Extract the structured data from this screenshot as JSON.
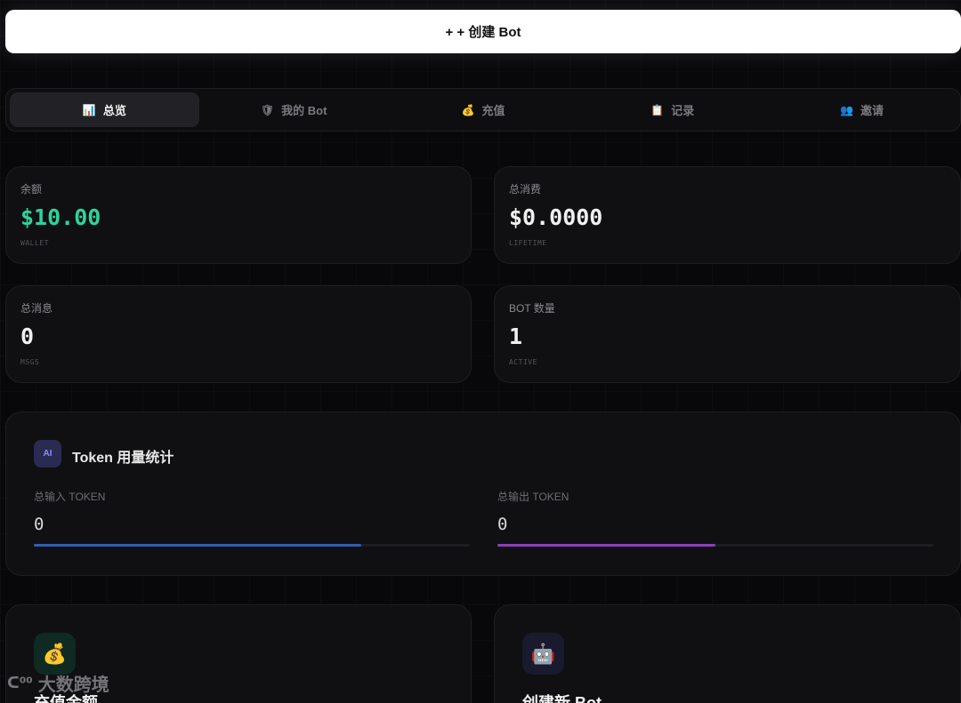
{
  "create_button": {
    "label": "+ + 创建 Bot"
  },
  "tabs": [
    {
      "icon": "📊",
      "label": "总览",
      "active": true
    },
    {
      "icon": "🛡",
      "label": "我的 Bot",
      "active": false
    },
    {
      "icon": "💰",
      "label": "充值",
      "active": false
    },
    {
      "icon": "📋",
      "label": "记录",
      "active": false
    },
    {
      "icon": "👥",
      "label": "邀请",
      "active": false
    }
  ],
  "stats": [
    {
      "label": "余额",
      "value": "$10.00",
      "sub": "WALLET",
      "color": "#2fd39a"
    },
    {
      "label": "总消费",
      "value": "$0.0000",
      "sub": "LIFETIME"
    },
    {
      "label": "总消息",
      "value": "0",
      "sub": "MSGS"
    },
    {
      "label": "BOT 数量",
      "value": "1",
      "sub": "ACTIVE"
    }
  ],
  "token_usage": {
    "badge": "AI",
    "title": "Token 用量统计",
    "input": {
      "label": "总输入 TOKEN",
      "value": "0",
      "fill": 0.75,
      "color": "#2f5fb0"
    },
    "output": {
      "label": "总输出 TOKEN",
      "value": "0",
      "fill": 0.5,
      "color": "#8a3fb8"
    }
  },
  "actions": [
    {
      "icon": "💰",
      "title": "充值金额",
      "bg": "#0f2a22"
    },
    {
      "icon": "🤖",
      "title": "创建新 Bot",
      "bg": "#1a1a2e"
    }
  ],
  "watermark": {
    "logo": "ᑕ⁰⁰",
    "text": "大数跨境"
  }
}
